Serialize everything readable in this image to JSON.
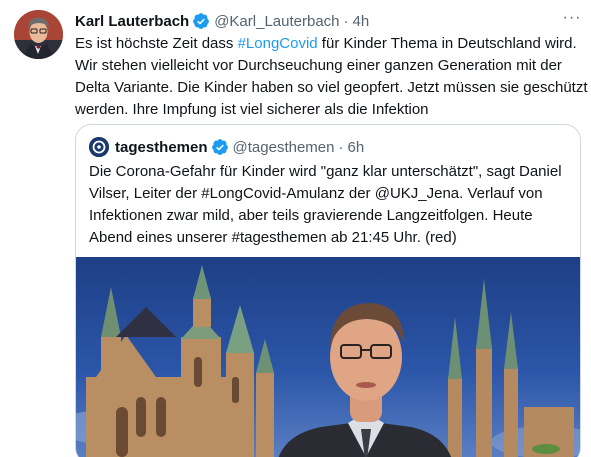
{
  "tweet": {
    "author_name": "Karl Lauterbach",
    "handle": "@Karl_Lauterbach",
    "separator": "·",
    "time": "4h",
    "more_label": "···",
    "text_lines": [
      [
        "Es ist höchste Zeit dass ",
        "#LongCovid",
        " für Kinder Thema in Deutschland wird."
      ],
      "Wir stehen vielleicht vor Durchseuchung einer ganzen Generation mit der",
      "Delta Variante. Die Kinder haben so viel geopfert. Jetzt müssen sie geschützt",
      "werden. Ihre Impfung ist viel sicherer als die Infektion"
    ]
  },
  "quoted_tweet": {
    "author_name": "tagesthemen",
    "handle": "@tagesthemen",
    "separator": "·",
    "time": "6h",
    "text_lines": [
      "Die Corona-Gefahr für Kinder wird \"ganz klar unterschätzt\", sagt Daniel",
      "Vilser, Leiter der #LongCovid-Amulanz der @UKJ_Jena. Verlauf von",
      "Infektionen zwar mild, aber teils gravierende Langzeitfolgen. Heute",
      "Abend eines unserer #tagesthemen ab 21:45 Uhr. (red)"
    ]
  },
  "colors": {
    "accent": "#1d9bf0",
    "text": "#0f1419",
    "secondary": "#536471",
    "border": "#cfd9de"
  },
  "icons": {
    "verified": "verified-badge-icon",
    "more": "more-horizontal-icon"
  }
}
